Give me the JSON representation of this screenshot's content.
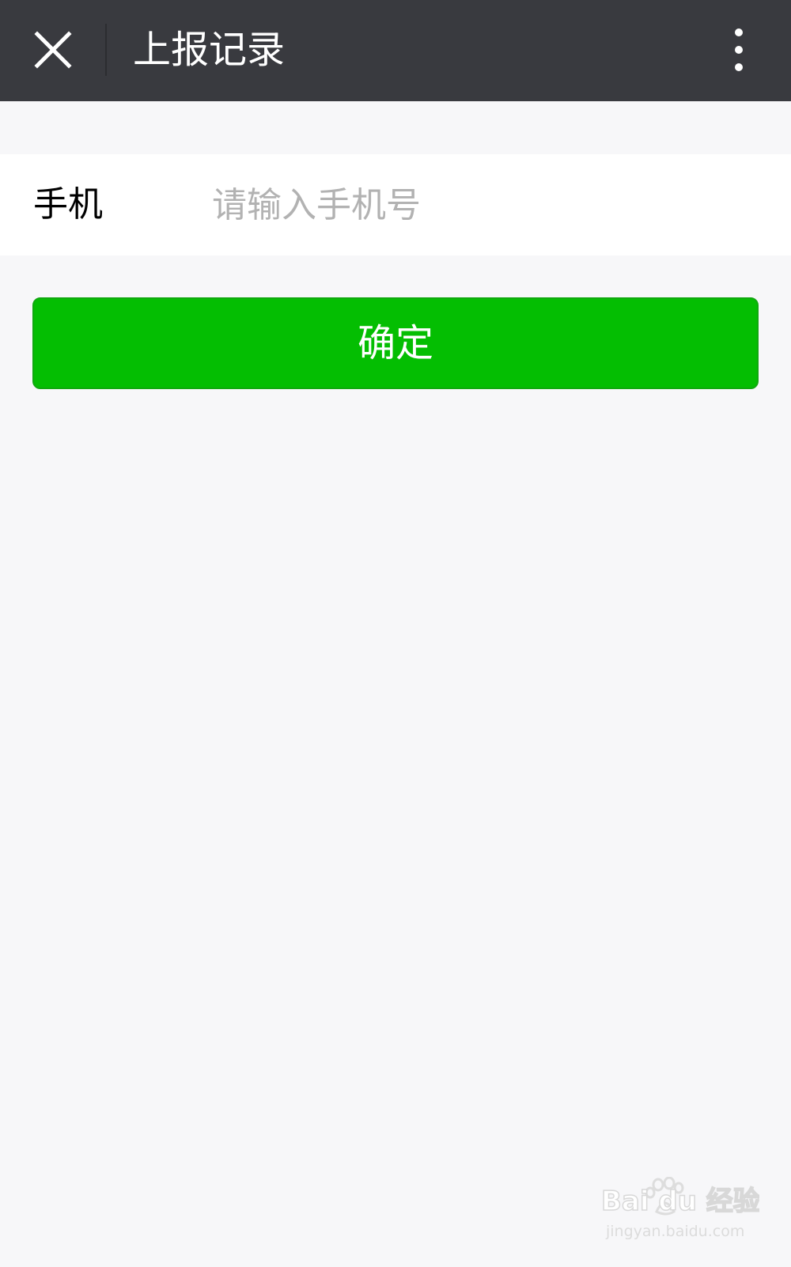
{
  "topbar": {
    "title": "上报记录",
    "close_icon": "close-icon",
    "more_icon": "more-vertical-icon"
  },
  "form": {
    "phone_label": "手机",
    "phone_placeholder": "请输入手机号",
    "phone_value": ""
  },
  "actions": {
    "confirm_label": "确定"
  },
  "watermark": {
    "logo_text": "Bai du 经验",
    "url": "jingyan.baidu.com"
  },
  "colors": {
    "topbar_bg": "#393a3f",
    "page_bg": "#f7f7f9",
    "primary_green": "#04be02",
    "placeholder_gray": "#b2b2b2"
  }
}
